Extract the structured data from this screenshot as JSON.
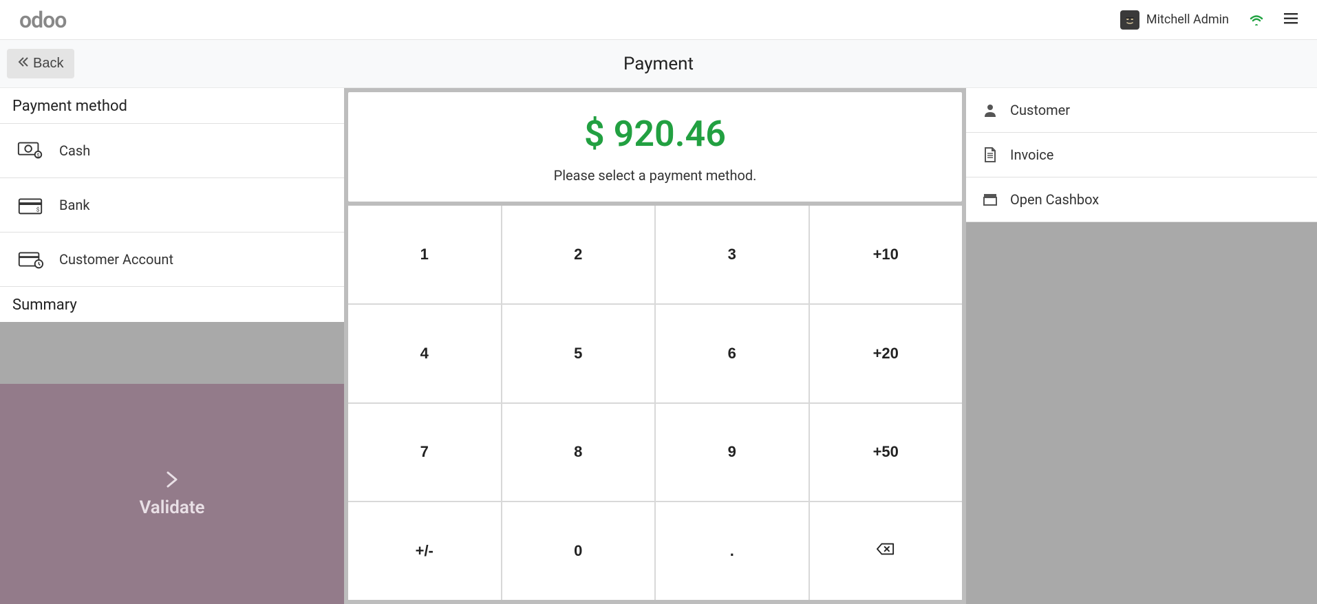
{
  "header": {
    "logo_text": "odoo",
    "user_name": "Mitchell Admin"
  },
  "subheader": {
    "back_label": "Back",
    "page_title": "Payment"
  },
  "left": {
    "section_heading": "Payment method",
    "methods": [
      {
        "label": "Cash"
      },
      {
        "label": "Bank"
      },
      {
        "label": "Customer Account"
      }
    ],
    "summary_heading": "Summary",
    "validate_label": "Validate"
  },
  "center": {
    "amount": "$ 920.46",
    "message": "Please select a payment method.",
    "numpad": {
      "row1": [
        "1",
        "2",
        "3",
        "+10"
      ],
      "row2": [
        "4",
        "5",
        "6",
        "+20"
      ],
      "row3": [
        "7",
        "8",
        "9",
        "+50"
      ],
      "row4": [
        "+/-",
        "0",
        ".",
        ""
      ]
    }
  },
  "right": {
    "actions": [
      {
        "label": "Customer"
      },
      {
        "label": "Invoice"
      },
      {
        "label": "Open Cashbox"
      }
    ]
  }
}
